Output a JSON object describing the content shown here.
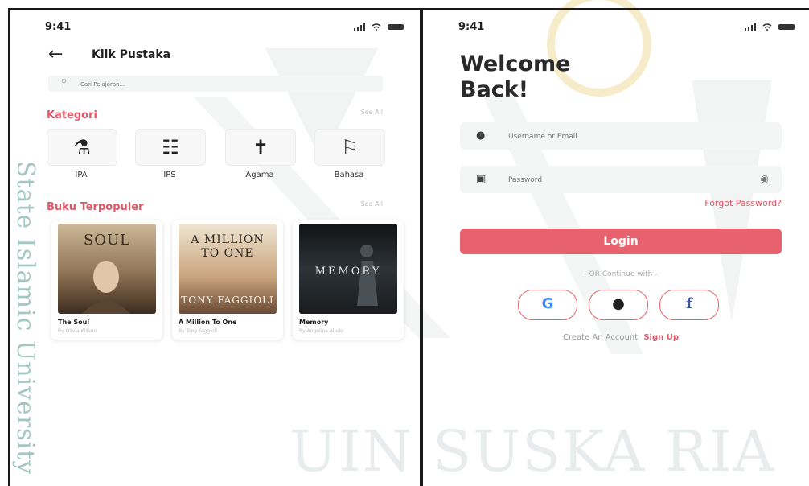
{
  "watermark": {
    "side_text": "State Islamic University",
    "bottom_text": "UIN SUSKA RIA"
  },
  "left_screen": {
    "status": {
      "time": "9:41"
    },
    "header": {
      "title": "Klik Pustaka"
    },
    "search": {
      "placeholder": "Cari Pelajaran..."
    },
    "kategori": {
      "title": "Kategori",
      "see_all": "See All",
      "items": [
        {
          "label": "IPA",
          "icon": "science-flask-icon"
        },
        {
          "label": "IPS",
          "icon": "social-chat-icon"
        },
        {
          "label": "Agama",
          "icon": "religion-icon"
        },
        {
          "label": "Bahasa",
          "icon": "language-icon"
        }
      ]
    },
    "populer": {
      "title": "Buku Terpopuler",
      "see_all": "See All",
      "books": [
        {
          "cover_text": "SOUL",
          "title": "The Soul",
          "author": "By Olivia Wilson"
        },
        {
          "cover_text": "A MILLION TO ONE",
          "cover_author": "TONY FAGGIOLI",
          "title": "A Million To One",
          "author": "By Tony Faggioli"
        },
        {
          "cover_text": "MEMORY",
          "title": "Memory",
          "author": "By Angelina Aludo"
        }
      ]
    }
  },
  "right_screen": {
    "status": {
      "time": "9:41"
    },
    "welcome": "Welcome Back!",
    "username": {
      "placeholder": "Username or Email",
      "icon": "user-icon"
    },
    "password": {
      "placeholder": "Password",
      "icon": "lock-icon"
    },
    "forgot": "Forgot Password?",
    "login_label": "Login",
    "or_text": "- OR Continue with -",
    "socials": [
      "G",
      "",
      "f"
    ],
    "create_text": "Create An Account",
    "signup_text": "Sign Up"
  },
  "colors": {
    "accent": "#e8616f",
    "watermark_teal": "#5d9a8f"
  }
}
